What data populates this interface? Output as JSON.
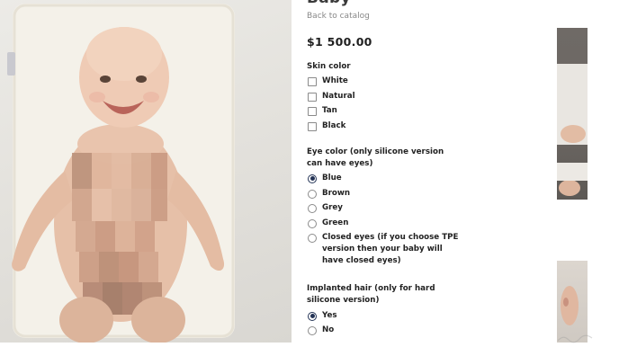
{
  "product": {
    "title": "Baby",
    "back_link": "Back to catalog",
    "price": "$1 500.00"
  },
  "skin_color": {
    "label": "Skin color",
    "options": [
      {
        "label": "White",
        "checked": false
      },
      {
        "label": "Natural",
        "checked": false
      },
      {
        "label": "Tan",
        "checked": false
      },
      {
        "label": "Black",
        "checked": false
      }
    ]
  },
  "eye_color": {
    "label": "Eye color (only silicone version can have eyes)",
    "selected": "Blue",
    "options": [
      {
        "label": "Blue"
      },
      {
        "label": "Brown"
      },
      {
        "label": "Grey"
      },
      {
        "label": "Green"
      },
      {
        "label": "Closed eyes (if you choose TPE version then your baby will have closed eyes)"
      }
    ]
  },
  "implanted_hair": {
    "label": "Implanted hair (only for hard silicone version)",
    "selected": "Yes",
    "options": [
      {
        "label": "Yes"
      },
      {
        "label": "No"
      }
    ]
  },
  "colors": {
    "radio_selected": "#233355",
    "text": "#222222",
    "muted_link": "#888888"
  },
  "icons": {
    "checkbox": "checkbox-icon",
    "radio": "radio-icon"
  }
}
